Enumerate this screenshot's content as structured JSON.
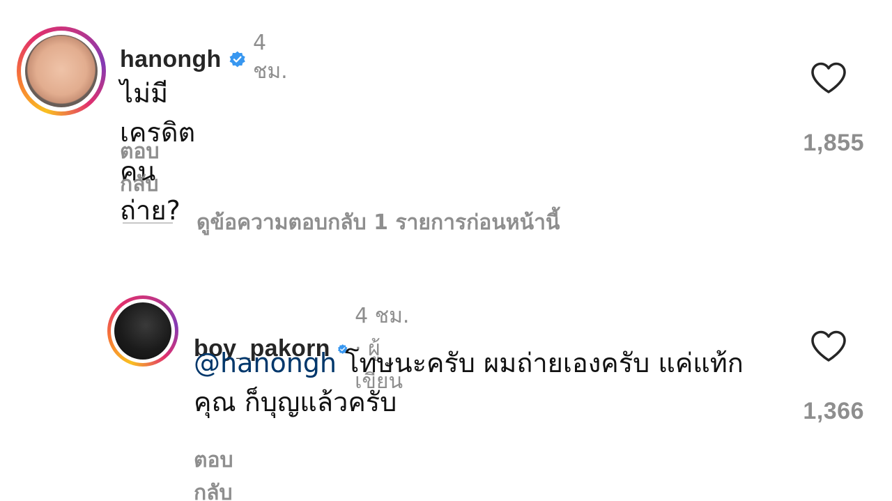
{
  "comments": [
    {
      "username": "hanongh",
      "verified_icon": "verified-badge-icon",
      "time": "4 ชม.",
      "text": "ไม่มีเครดิตคนถ่าย?",
      "reply_label": "ตอบกลับ",
      "likes": "1,855",
      "like_icon": "heart-outline-icon"
    },
    {
      "username": "boy_pakorn",
      "verified_icon": "verified-badge-icon",
      "time_meta": "4 ชม. · ผู้เขียน",
      "mention": "@hanongh",
      "text": " โทษนะครับ ผมถ่ายเองครับ แค่แท้กคุณ ก็บุญแล้วครับ",
      "reply_label": "ตอบกลับ",
      "likes": "1,366",
      "like_icon": "heart-outline-icon"
    }
  ],
  "view_previous_replies": "ดูข้อความตอบกลับ 1 รายการก่อนหน้านี้",
  "colors": {
    "verified_blue": "#3897f0",
    "muted_gray": "#8e8e8e",
    "mention_blue": "#00376b",
    "text": "#111111"
  }
}
